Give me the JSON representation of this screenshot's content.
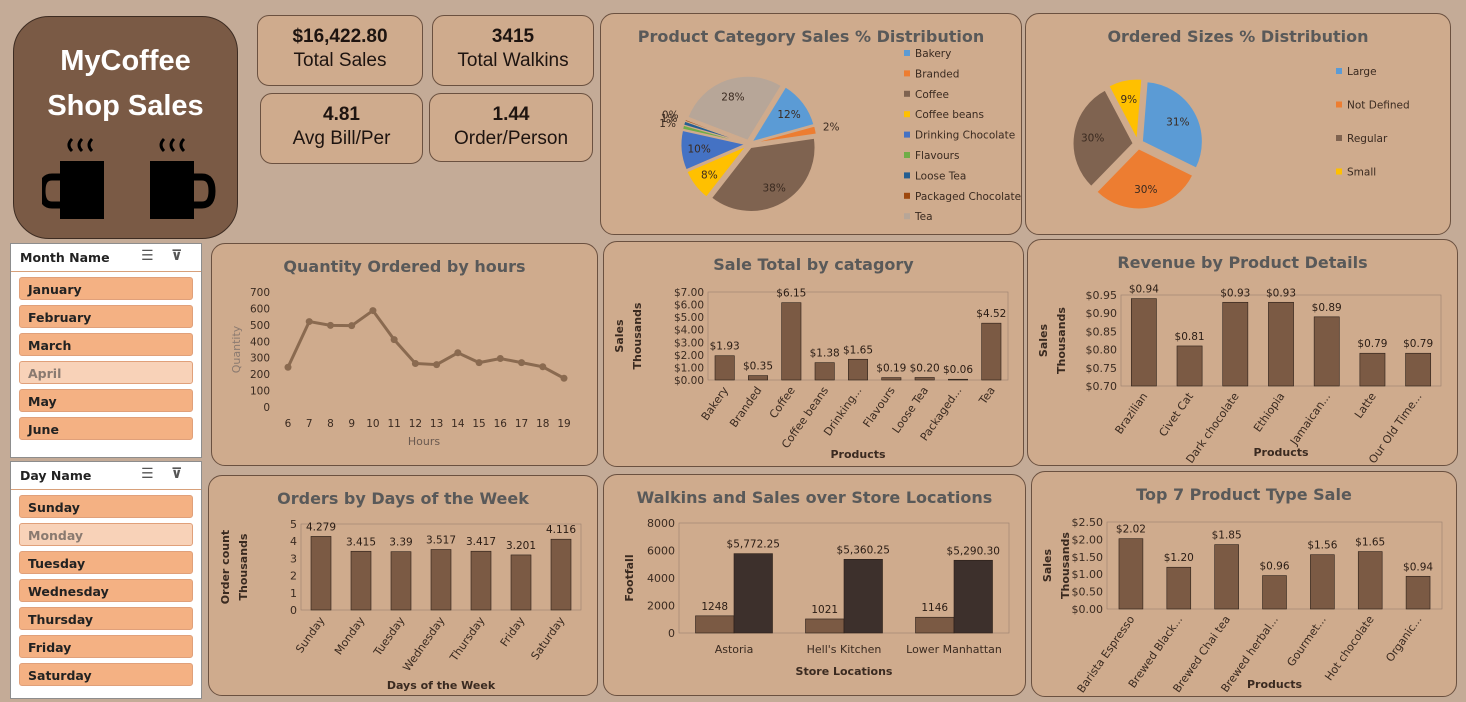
{
  "logo": {
    "line1": "MyCoffee",
    "line2": "Shop Sales"
  },
  "kpis": [
    {
      "value": "$16,422.80",
      "label": "Total Sales"
    },
    {
      "value": "3415",
      "label": "Total Walkins"
    },
    {
      "value": "4.81",
      "label": "Avg Bill/Per"
    },
    {
      "value": "1.44",
      "label": "Order/Person"
    }
  ],
  "month_slicer": {
    "title": "Month Name",
    "items": [
      "January",
      "February",
      "March",
      "April",
      "May",
      "June"
    ],
    "unselected": [
      "April"
    ]
  },
  "day_slicer": {
    "title": "Day Name",
    "items": [
      "Sunday",
      "Monday",
      "Tuesday",
      "Wednesday",
      "Thursday",
      "Friday",
      "Saturday"
    ],
    "unselected": [
      "Monday"
    ]
  },
  "colors": {
    "bar": "#7b5a44",
    "bar_dark": "#3d302c",
    "line": "#8a6a50",
    "panel": "#cfab8d",
    "border": "#6b5140"
  },
  "chart_data": [
    {
      "id": "category_pie",
      "type": "pie",
      "title": "Product Category Sales % Distribution",
      "slices": [
        {
          "name": "Bakery",
          "value": 12,
          "label": "12%",
          "color": "#5b9bd5"
        },
        {
          "name": "Branded",
          "value": 2,
          "label": "2%",
          "color": "#ed7d31"
        },
        {
          "name": "Coffee",
          "value": 38,
          "label": "38%",
          "color": "#7f6350"
        },
        {
          "name": "Coffee beans",
          "value": 8,
          "label": "8%",
          "color": "#ffc000"
        },
        {
          "name": "Drinking Chocolate",
          "value": 10,
          "label": "10%",
          "color": "#4472c4"
        },
        {
          "name": "Flavours",
          "value": 1,
          "label": "1%",
          "color": "#70ad47"
        },
        {
          "name": "Loose Tea",
          "value": 1,
          "label": "1%",
          "color": "#255e91"
        },
        {
          "name": "Packaged Chocolate",
          "value": 0.4,
          "label": "0%",
          "color": "#9e480e"
        },
        {
          "name": "Tea",
          "value": 28,
          "label": "28%",
          "color": "#b7a698"
        }
      ]
    },
    {
      "id": "size_pie",
      "type": "pie",
      "title": "Ordered Sizes % Distribution",
      "slices": [
        {
          "name": "Large",
          "value": 31,
          "label": "31%",
          "color": "#5b9bd5"
        },
        {
          "name": "Not Defined",
          "value": 30,
          "label": "30%",
          "color": "#ed7d31"
        },
        {
          "name": "Regular",
          "value": 30,
          "label": "30%",
          "color": "#7f6350"
        },
        {
          "name": "Small",
          "value": 9,
          "label": "9%",
          "color": "#ffc000"
        }
      ]
    },
    {
      "id": "hours_line",
      "type": "line",
      "title": "Quantity Ordered by hours",
      "xlabel": "Hours",
      "ylabel": "Quantity",
      "ylim": [
        0,
        700
      ],
      "yticks": [
        "0",
        "100",
        "200",
        "300",
        "400",
        "500",
        "600",
        "700"
      ],
      "x": [
        "6",
        "7",
        "8",
        "9",
        "10",
        "11",
        "12",
        "13",
        "14",
        "15",
        "16",
        "17",
        "18",
        "19"
      ],
      "values": [
        242,
        520,
        497,
        495,
        587,
        410,
        265,
        258,
        330,
        270,
        295,
        270,
        245,
        175
      ]
    },
    {
      "id": "category_bar",
      "type": "bar",
      "title": "Sale Total by catagory",
      "xlabel": "Products",
      "ylabel": "Sales",
      "ylabel2": "Thousands",
      "ylim": [
        0,
        7
      ],
      "yticks": [
        "$0.00",
        "$1.00",
        "$2.00",
        "$3.00",
        "$4.00",
        "$5.00",
        "$6.00",
        "$7.00"
      ],
      "categories": [
        "Bakery",
        "Branded",
        "Coffee",
        "Coffee beans",
        "Drinking...",
        "Flavours",
        "Loose Tea",
        "Packaged...",
        "Tea"
      ],
      "values": [
        1.93,
        0.35,
        6.15,
        1.38,
        1.65,
        0.19,
        0.2,
        0.06,
        4.52
      ],
      "labels": [
        "$1.93",
        "$0.35",
        "$6.15",
        "$1.38",
        "$1.65",
        "$0.19",
        "$0.20",
        "$0.06",
        "$4.52"
      ]
    },
    {
      "id": "product_bar",
      "type": "bar",
      "title": "Revenue by Product Details",
      "xlabel": "Products",
      "ylabel": "Sales",
      "ylabel2": "Thousands",
      "ylim": [
        0.7,
        0.95
      ],
      "yticks": [
        "$0.70",
        "$0.75",
        "$0.80",
        "$0.85",
        "$0.90",
        "$0.95"
      ],
      "categories": [
        "Brazilian",
        "Civet Cat",
        "Dark chocolate",
        "Ethiopia",
        "Jamaican...",
        "Latte",
        "Our Old Time..."
      ],
      "values": [
        0.94,
        0.81,
        0.93,
        0.93,
        0.89,
        0.79,
        0.79
      ],
      "labels": [
        "$0.94",
        "$0.81",
        "$0.93",
        "$0.93",
        "$0.89",
        "$0.79",
        "$0.79"
      ]
    },
    {
      "id": "days_bar",
      "type": "bar",
      "title": "Orders by Days of the Week",
      "xlabel": "Days of the Week",
      "ylabel": "Order count",
      "ylabel2": "Thousands",
      "ylim": [
        0,
        5
      ],
      "yticks": [
        "0",
        "1",
        "2",
        "3",
        "4",
        "5"
      ],
      "categories": [
        "Sunday",
        "Monday",
        "Tuesday",
        "Wednesday",
        "Thursday",
        "Friday",
        "Saturday"
      ],
      "values": [
        4.279,
        3.415,
        3.39,
        3.517,
        3.417,
        3.201,
        4.116
      ],
      "labels": [
        "4.279",
        "3.415",
        "3.39",
        "3.517",
        "3.417",
        "3.201",
        "4.116"
      ]
    },
    {
      "id": "locations_bar",
      "type": "bar",
      "title": "Walkins and Sales over Store Locations",
      "xlabel": "Store Locations",
      "ylabel": "Footfall",
      "ylim": [
        0,
        8000
      ],
      "yticks": [
        "0",
        "2000",
        "4000",
        "6000",
        "8000"
      ],
      "categories": [
        "Astoria",
        "Hell's Kitchen",
        "Lower Manhattan"
      ],
      "series": [
        {
          "values": [
            1248,
            1021,
            1146
          ],
          "labels": [
            "1248",
            "1021",
            "1146"
          ]
        },
        {
          "values": [
            5772.25,
            5360.25,
            5290.3
          ],
          "labels": [
            "$5,772.25",
            "$5,360.25",
            "$5,290.30"
          ]
        }
      ]
    },
    {
      "id": "top7_bar",
      "type": "bar",
      "title": "Top 7 Product Type Sale",
      "xlabel": "Products",
      "ylabel": "Sales",
      "ylabel2": "Thousands",
      "ylim": [
        0,
        2.5
      ],
      "yticks": [
        "$0.00",
        "$0.50",
        "$1.00",
        "$1.50",
        "$2.00",
        "$2.50"
      ],
      "categories": [
        "Barista Espresso",
        "Brewed Black...",
        "Brewed Chai tea",
        "Brewed herbal...",
        "Gourmet...",
        "Hot chocolate",
        "Organic..."
      ],
      "values": [
        2.02,
        1.2,
        1.85,
        0.96,
        1.56,
        1.65,
        0.94
      ],
      "labels": [
        "$2.02",
        "$1.20",
        "$1.85",
        "$0.96",
        "$1.56",
        "$1.65",
        "$0.94"
      ]
    }
  ]
}
